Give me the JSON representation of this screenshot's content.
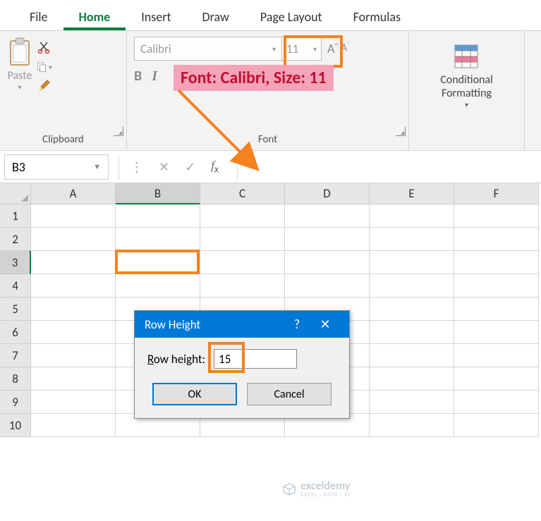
{
  "tabs": {
    "file": "File",
    "home": "Home",
    "insert": "Insert",
    "draw": "Draw",
    "pagelayout": "Page Layout",
    "formulas": "Formulas"
  },
  "clipboard": {
    "paste": "Paste",
    "group": "Clipboard"
  },
  "font": {
    "name": "Calibri",
    "size": "11",
    "group": "Font",
    "annotation": "Font: Calibri, Size: 11"
  },
  "cond": {
    "label": "Conditional\nFormatting"
  },
  "namebox": "B3",
  "columns": [
    "A",
    "B",
    "C",
    "D",
    "E",
    "F"
  ],
  "rows": [
    "1",
    "2",
    "3",
    "4",
    "5",
    "6",
    "7",
    "8",
    "9",
    "10"
  ],
  "dialog": {
    "title": "Row Height",
    "label_pre": "R",
    "label_post": "ow height:",
    "value": "15",
    "ok": "OK",
    "cancel": "Cancel"
  },
  "watermark": {
    "main": "exceldemy",
    "sub": "EXCEL · DATA · BI"
  }
}
